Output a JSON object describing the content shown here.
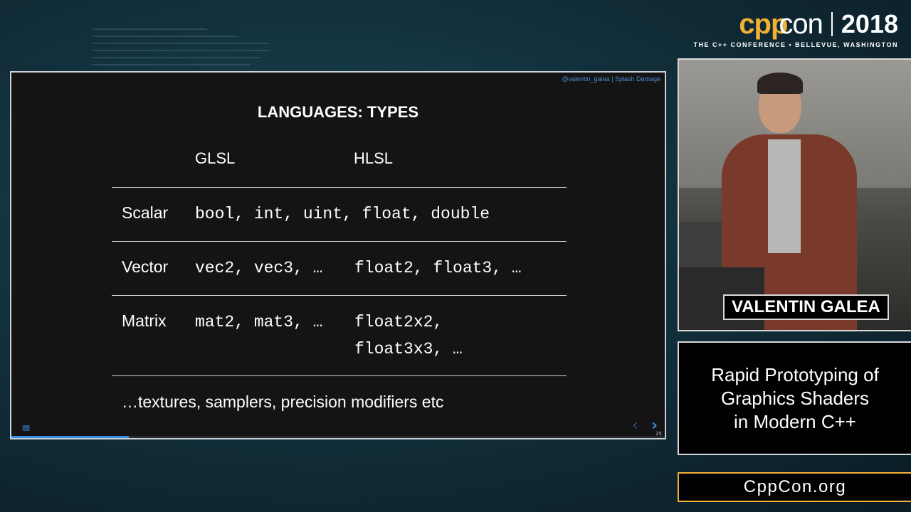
{
  "brand": {
    "cpp": "cpp",
    "con": "con",
    "year": "2018",
    "subtitle": "THE C++ CONFERENCE • BELLEVUE, WASHINGTON"
  },
  "slide": {
    "credit": "@valentin_galea | Splash Damage",
    "title": "LANGUAGES: TYPES",
    "columns": [
      "GLSL",
      "HLSL"
    ],
    "rows": [
      {
        "label": "Scalar",
        "shared": "bool, int, uint, float, double"
      },
      {
        "label": "Vector",
        "glsl": "vec2, vec3, …",
        "hlsl": "float2, float3, …"
      },
      {
        "label": "Matrix",
        "glsl": "mat2, mat3, …",
        "hlsl_line1": "float2x2,",
        "hlsl_line2": "float3x3, …"
      }
    ],
    "footnote": "…textures, samplers, precision modifiers etc",
    "slide_number": "25",
    "progress_fraction": 0.18
  },
  "speaker": {
    "name": "VALENTIN GALEA"
  },
  "talk": {
    "title_line1": "Rapid Prototyping of",
    "title_line2": "Graphics Shaders",
    "title_line3": "in Modern C++"
  },
  "website": "CppCon.org",
  "colors": {
    "accent_gold": "#f2b134",
    "accent_blue": "#3a8de0",
    "slide_bg": "#141414"
  },
  "icons": {
    "menu": "hamburger-menu-icon",
    "prev": "chevron-left-icon",
    "next": "chevron-right-icon"
  }
}
